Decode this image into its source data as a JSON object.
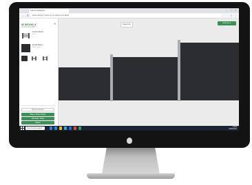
{
  "browser": {
    "tab_title": "Fence Designer",
    "url": "www.designmyfence.co.uk/fence-builder",
    "back_icon": "arrow-left-icon",
    "forward_icon": "arrow-right-icon",
    "reload_icon": "reload-icon",
    "menu_icon": "more-vert-icon"
  },
  "sidebar": {
    "brand": "W WOOD 4",
    "brand_sub": "FENCE BUILDER",
    "close_icon": "close-icon",
    "products": [
      {
        "title": "Louvre Fence",
        "meta": "Panel",
        "swatch_color": "#2b2d30"
      },
      {
        "title": "Fence Panel",
        "meta": "Black / Grey",
        "swatch_color": "#2b2d30"
      }
    ],
    "buttons": {
      "outline": "Remove Section",
      "primary_1": "Save & Share Design",
      "primary_2": "Add Gate / Panel",
      "primary_3": "Basket"
    }
  },
  "canvas": {
    "tooltip": "Panel Info",
    "cta": "Add Item ▸",
    "panel_color": "#2b2d30",
    "post_color": "#a9adb2",
    "background_color": "#ebebeb"
  },
  "taskbar": {
    "search_placeholder": "Type here to search",
    "time": "14:32",
    "date": "12/05/2021",
    "start_icon": "windows-start-icon"
  },
  "colors": {
    "accent": "#3e8e57",
    "bezel": "#131313"
  }
}
